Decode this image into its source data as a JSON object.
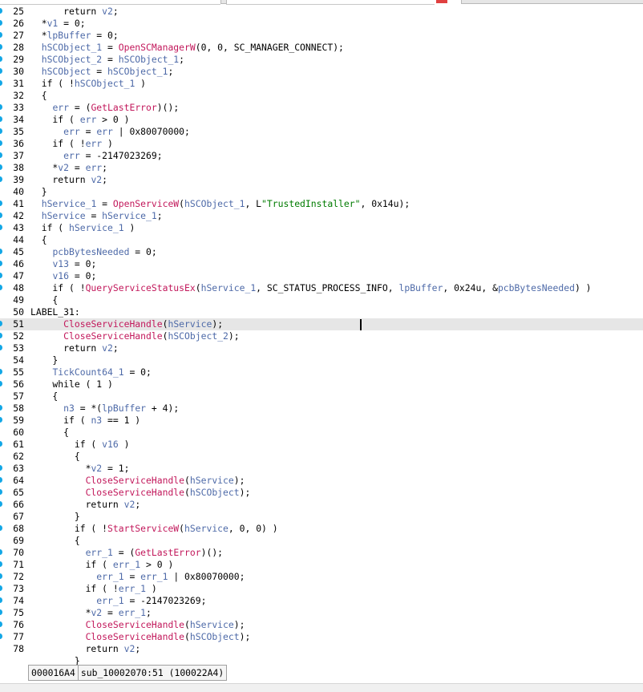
{
  "lines": [
    {
      "ln": "25",
      "marker": true,
      "hl": false,
      "tokens": [
        [
          "      return ",
          ""
        ],
        [
          "v2",
          "v"
        ],
        [
          ";",
          ""
        ]
      ]
    },
    {
      "ln": "26",
      "marker": true,
      "hl": false,
      "tokens": [
        [
          "  *",
          ""
        ],
        [
          "v1",
          "v"
        ],
        [
          " = 0;",
          ""
        ]
      ]
    },
    {
      "ln": "27",
      "marker": true,
      "hl": false,
      "tokens": [
        [
          "  *",
          ""
        ],
        [
          "lpBuffer",
          "v"
        ],
        [
          " = 0;",
          ""
        ]
      ]
    },
    {
      "ln": "28",
      "marker": true,
      "hl": false,
      "tokens": [
        [
          "  ",
          ""
        ],
        [
          "hSCObject_1",
          "v"
        ],
        [
          " = ",
          ""
        ],
        [
          "OpenSCManagerW",
          "f"
        ],
        [
          "(0, 0, SC_MANAGER_CONNECT);",
          ""
        ]
      ]
    },
    {
      "ln": "29",
      "marker": true,
      "hl": false,
      "tokens": [
        [
          "  ",
          ""
        ],
        [
          "hSCObject_2",
          "v"
        ],
        [
          " = ",
          ""
        ],
        [
          "hSCObject_1",
          "v"
        ],
        [
          ";",
          ""
        ]
      ]
    },
    {
      "ln": "30",
      "marker": true,
      "hl": false,
      "tokens": [
        [
          "  ",
          ""
        ],
        [
          "hSCObject",
          "v"
        ],
        [
          " = ",
          ""
        ],
        [
          "hSCObject_1",
          "v"
        ],
        [
          ";",
          ""
        ]
      ]
    },
    {
      "ln": "31",
      "marker": true,
      "hl": false,
      "tokens": [
        [
          "  if ( !",
          ""
        ],
        [
          "hSCObject_1",
          "v"
        ],
        [
          " )",
          ""
        ]
      ]
    },
    {
      "ln": "32",
      "marker": false,
      "hl": false,
      "tokens": [
        [
          "  {",
          ""
        ]
      ]
    },
    {
      "ln": "33",
      "marker": true,
      "hl": false,
      "tokens": [
        [
          "    ",
          ""
        ],
        [
          "err",
          "v"
        ],
        [
          " = (",
          ""
        ],
        [
          "GetLastError",
          "f"
        ],
        [
          ")();",
          ""
        ]
      ]
    },
    {
      "ln": "34",
      "marker": true,
      "hl": false,
      "tokens": [
        [
          "    if ( ",
          ""
        ],
        [
          "err",
          "v"
        ],
        [
          " > 0 )",
          ""
        ]
      ]
    },
    {
      "ln": "35",
      "marker": true,
      "hl": false,
      "tokens": [
        [
          "      ",
          ""
        ],
        [
          "err",
          "v"
        ],
        [
          " = ",
          ""
        ],
        [
          "err",
          "v"
        ],
        [
          " | 0x80070000;",
          ""
        ]
      ]
    },
    {
      "ln": "36",
      "marker": true,
      "hl": false,
      "tokens": [
        [
          "    if ( !",
          ""
        ],
        [
          "err",
          "v"
        ],
        [
          " )",
          ""
        ]
      ]
    },
    {
      "ln": "37",
      "marker": true,
      "hl": false,
      "tokens": [
        [
          "      ",
          ""
        ],
        [
          "err",
          "v"
        ],
        [
          " = -2147023269;",
          ""
        ]
      ]
    },
    {
      "ln": "38",
      "marker": true,
      "hl": false,
      "tokens": [
        [
          "    *",
          ""
        ],
        [
          "v2",
          "v"
        ],
        [
          " = ",
          ""
        ],
        [
          "err",
          "v"
        ],
        [
          ";",
          ""
        ]
      ]
    },
    {
      "ln": "39",
      "marker": true,
      "hl": false,
      "tokens": [
        [
          "    return ",
          ""
        ],
        [
          "v2",
          "v"
        ],
        [
          ";",
          ""
        ]
      ]
    },
    {
      "ln": "40",
      "marker": false,
      "hl": false,
      "tokens": [
        [
          "  }",
          ""
        ]
      ]
    },
    {
      "ln": "41",
      "marker": true,
      "hl": false,
      "tokens": [
        [
          "  ",
          ""
        ],
        [
          "hService_1",
          "v"
        ],
        [
          " = ",
          ""
        ],
        [
          "OpenServiceW",
          "f"
        ],
        [
          "(",
          ""
        ],
        [
          "hSCObject_1",
          "v"
        ],
        [
          ", L",
          ""
        ],
        [
          "\"TrustedInstaller\"",
          "s"
        ],
        [
          ", 0x14u);",
          ""
        ]
      ]
    },
    {
      "ln": "42",
      "marker": true,
      "hl": false,
      "tokens": [
        [
          "  ",
          ""
        ],
        [
          "hService",
          "v"
        ],
        [
          " = ",
          ""
        ],
        [
          "hService_1",
          "v"
        ],
        [
          ";",
          ""
        ]
      ]
    },
    {
      "ln": "43",
      "marker": true,
      "hl": false,
      "tokens": [
        [
          "  if ( ",
          ""
        ],
        [
          "hService_1",
          "v"
        ],
        [
          " )",
          ""
        ]
      ]
    },
    {
      "ln": "44",
      "marker": false,
      "hl": false,
      "tokens": [
        [
          "  {",
          ""
        ]
      ]
    },
    {
      "ln": "45",
      "marker": true,
      "hl": false,
      "tokens": [
        [
          "    ",
          ""
        ],
        [
          "pcbBytesNeeded",
          "v"
        ],
        [
          " = 0;",
          ""
        ]
      ]
    },
    {
      "ln": "46",
      "marker": true,
      "hl": false,
      "tokens": [
        [
          "    ",
          ""
        ],
        [
          "v13",
          "v"
        ],
        [
          " = 0;",
          ""
        ]
      ]
    },
    {
      "ln": "47",
      "marker": true,
      "hl": false,
      "tokens": [
        [
          "    ",
          ""
        ],
        [
          "v16",
          "v"
        ],
        [
          " = 0;",
          ""
        ]
      ]
    },
    {
      "ln": "48",
      "marker": true,
      "hl": false,
      "tokens": [
        [
          "    if ( !",
          ""
        ],
        [
          "QueryServiceStatusEx",
          "f"
        ],
        [
          "(",
          ""
        ],
        [
          "hService_1",
          "v"
        ],
        [
          ", SC_STATUS_PROCESS_INFO, ",
          ""
        ],
        [
          "lpBuffer",
          "v"
        ],
        [
          ", 0x24u, &",
          ""
        ],
        [
          "pcbBytesNeeded",
          "v"
        ],
        [
          ") )",
          ""
        ]
      ]
    },
    {
      "ln": "49",
      "marker": false,
      "hl": false,
      "tokens": [
        [
          "    {",
          ""
        ]
      ]
    },
    {
      "ln": "50",
      "marker": false,
      "hl": false,
      "tokens": [
        [
          "LABEL_31:",
          ""
        ]
      ]
    },
    {
      "ln": "51",
      "marker": true,
      "hl": true,
      "tokens": [
        [
          "      ",
          ""
        ],
        [
          "CloseServiceHandle",
          "f"
        ],
        [
          "(",
          ""
        ],
        [
          "hService",
          "v"
        ],
        [
          ");",
          ""
        ]
      ]
    },
    {
      "ln": "52",
      "marker": true,
      "hl": false,
      "tokens": [
        [
          "      ",
          ""
        ],
        [
          "CloseServiceHandle",
          "f"
        ],
        [
          "(",
          ""
        ],
        [
          "hSCObject_2",
          "v"
        ],
        [
          ");",
          ""
        ]
      ]
    },
    {
      "ln": "53",
      "marker": true,
      "hl": false,
      "tokens": [
        [
          "      return ",
          ""
        ],
        [
          "v2",
          "v"
        ],
        [
          ";",
          ""
        ]
      ]
    },
    {
      "ln": "54",
      "marker": false,
      "hl": false,
      "tokens": [
        [
          "    }",
          ""
        ]
      ]
    },
    {
      "ln": "55",
      "marker": true,
      "hl": false,
      "tokens": [
        [
          "    ",
          ""
        ],
        [
          "TickCount64_1",
          "v"
        ],
        [
          " = 0;",
          ""
        ]
      ]
    },
    {
      "ln": "56",
      "marker": true,
      "hl": false,
      "tokens": [
        [
          "    while ( 1 )",
          ""
        ]
      ]
    },
    {
      "ln": "57",
      "marker": false,
      "hl": false,
      "tokens": [
        [
          "    {",
          ""
        ]
      ]
    },
    {
      "ln": "58",
      "marker": true,
      "hl": false,
      "tokens": [
        [
          "      ",
          ""
        ],
        [
          "n3",
          "v"
        ],
        [
          " = *(",
          ""
        ],
        [
          "lpBuffer",
          "v"
        ],
        [
          " + 4);",
          ""
        ]
      ]
    },
    {
      "ln": "59",
      "marker": true,
      "hl": false,
      "tokens": [
        [
          "      if ( ",
          ""
        ],
        [
          "n3",
          "v"
        ],
        [
          " == 1 )",
          ""
        ]
      ]
    },
    {
      "ln": "60",
      "marker": false,
      "hl": false,
      "tokens": [
        [
          "      {",
          ""
        ]
      ]
    },
    {
      "ln": "61",
      "marker": true,
      "hl": false,
      "tokens": [
        [
          "        if ( ",
          ""
        ],
        [
          "v16",
          "v"
        ],
        [
          " )",
          ""
        ]
      ]
    },
    {
      "ln": "62",
      "marker": false,
      "hl": false,
      "tokens": [
        [
          "        {",
          ""
        ]
      ]
    },
    {
      "ln": "63",
      "marker": true,
      "hl": false,
      "tokens": [
        [
          "          *",
          ""
        ],
        [
          "v2",
          "v"
        ],
        [
          " = 1;",
          ""
        ]
      ]
    },
    {
      "ln": "64",
      "marker": true,
      "hl": false,
      "tokens": [
        [
          "          ",
          ""
        ],
        [
          "CloseServiceHandle",
          "f"
        ],
        [
          "(",
          ""
        ],
        [
          "hService",
          "v"
        ],
        [
          ");",
          ""
        ]
      ]
    },
    {
      "ln": "65",
      "marker": true,
      "hl": false,
      "tokens": [
        [
          "          ",
          ""
        ],
        [
          "CloseServiceHandle",
          "f"
        ],
        [
          "(",
          ""
        ],
        [
          "hSCObject",
          "v"
        ],
        [
          ");",
          ""
        ]
      ]
    },
    {
      "ln": "66",
      "marker": true,
      "hl": false,
      "tokens": [
        [
          "          return ",
          ""
        ],
        [
          "v2",
          "v"
        ],
        [
          ";",
          ""
        ]
      ]
    },
    {
      "ln": "67",
      "marker": false,
      "hl": false,
      "tokens": [
        [
          "        }",
          ""
        ]
      ]
    },
    {
      "ln": "68",
      "marker": true,
      "hl": false,
      "tokens": [
        [
          "        if ( !",
          ""
        ],
        [
          "StartServiceW",
          "f"
        ],
        [
          "(",
          ""
        ],
        [
          "hService",
          "v"
        ],
        [
          ", 0, 0) )",
          ""
        ]
      ]
    },
    {
      "ln": "69",
      "marker": false,
      "hl": false,
      "tokens": [
        [
          "        {",
          ""
        ]
      ]
    },
    {
      "ln": "70",
      "marker": true,
      "hl": false,
      "tokens": [
        [
          "          ",
          ""
        ],
        [
          "err_1",
          "v"
        ],
        [
          " = (",
          ""
        ],
        [
          "GetLastError",
          "f"
        ],
        [
          ")();",
          ""
        ]
      ]
    },
    {
      "ln": "71",
      "marker": true,
      "hl": false,
      "tokens": [
        [
          "          if ( ",
          ""
        ],
        [
          "err_1",
          "v"
        ],
        [
          " > 0 )",
          ""
        ]
      ]
    },
    {
      "ln": "72",
      "marker": true,
      "hl": false,
      "tokens": [
        [
          "            ",
          ""
        ],
        [
          "err_1",
          "v"
        ],
        [
          " = ",
          ""
        ],
        [
          "err_1",
          "v"
        ],
        [
          " | 0x80070000;",
          ""
        ]
      ]
    },
    {
      "ln": "73",
      "marker": true,
      "hl": false,
      "tokens": [
        [
          "          if ( !",
          ""
        ],
        [
          "err_1",
          "v"
        ],
        [
          " )",
          ""
        ]
      ]
    },
    {
      "ln": "74",
      "marker": true,
      "hl": false,
      "tokens": [
        [
          "            ",
          ""
        ],
        [
          "err_1",
          "v"
        ],
        [
          " = -2147023269;",
          ""
        ]
      ]
    },
    {
      "ln": "75",
      "marker": true,
      "hl": false,
      "tokens": [
        [
          "          *",
          ""
        ],
        [
          "v2",
          "v"
        ],
        [
          " = ",
          ""
        ],
        [
          "err_1",
          "v"
        ],
        [
          ";",
          ""
        ]
      ]
    },
    {
      "ln": "76",
      "marker": true,
      "hl": false,
      "tokens": [
        [
          "          ",
          ""
        ],
        [
          "CloseServiceHandle",
          "f"
        ],
        [
          "(",
          ""
        ],
        [
          "hService",
          "v"
        ],
        [
          ");",
          ""
        ]
      ]
    },
    {
      "ln": "77",
      "marker": true,
      "hl": false,
      "tokens": [
        [
          "          ",
          ""
        ],
        [
          "CloseServiceHandle",
          "f"
        ],
        [
          "(",
          ""
        ],
        [
          "hSCObject",
          "v"
        ],
        [
          ");",
          ""
        ]
      ]
    },
    {
      "ln": "78",
      "marker": false,
      "hl": false,
      "tokens": [
        [
          "          return ",
          ""
        ],
        [
          "v2",
          "v"
        ],
        [
          ";",
          ""
        ]
      ]
    },
    {
      "ln": "",
      "marker": false,
      "hl": false,
      "tokens": [
        [
          "        }",
          ""
        ]
      ]
    }
  ],
  "status": {
    "address": "000016A4",
    "location": "sub_10002070:51 (100022A4)"
  },
  "colors": {
    "variable": "#4e6aa8",
    "function": "#c2185b",
    "string": "#007b00",
    "marker": "#12a7e6",
    "highlight": "#e6e6e6"
  }
}
